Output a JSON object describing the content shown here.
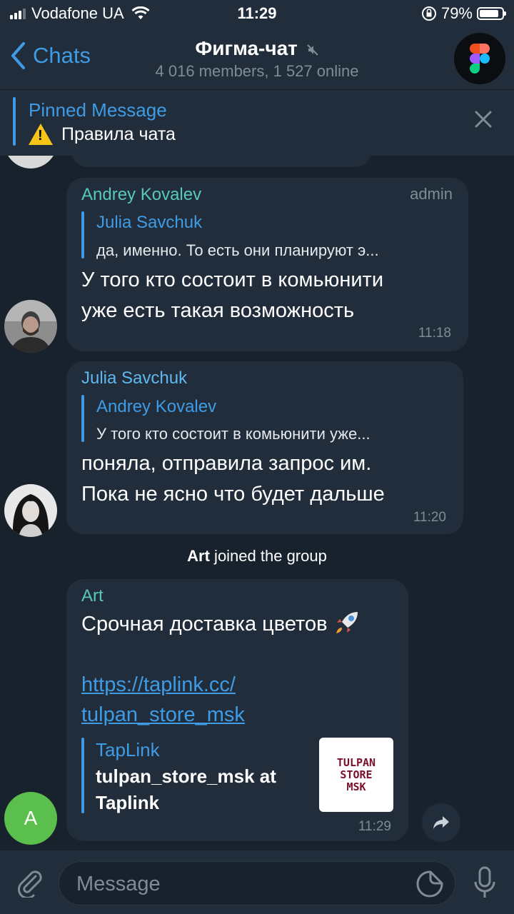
{
  "status": {
    "carrier": "Vodafone UA",
    "time": "11:29",
    "battery": "79%"
  },
  "nav": {
    "back_label": "Chats",
    "title": "Фигма-чат",
    "subtitle": "4 016 members, 1 527 online"
  },
  "pinned": {
    "title": "Pinned Message",
    "text": "Правила чата"
  },
  "messages": [
    {
      "sender": "Andrey Kovalev",
      "role": "admin",
      "reply_name": "Julia Savchuk",
      "reply_text": "да, именно. То есть они планируют э...",
      "text_line1": "У того кто состоит в комьюнити",
      "text_line2": "уже есть такая возможность",
      "time": "11:18",
      "sender_color": "#57c9b9"
    },
    {
      "sender": "Julia Savchuk",
      "reply_name": "Andrey Kovalev",
      "reply_text": "У того кто состоит в комьюнити уже...",
      "text_line1": "поняла, отправила запрос им.",
      "text_line2": "Пока не ясно что будет дальше",
      "time": "11:20",
      "sender_color": "#5fb8ef"
    },
    {
      "sender": "Art",
      "text": "Срочная доставка цветов",
      "link_line1": "https://taplink.cc/",
      "link_line2": "tulpan_store_msk",
      "preview_site": "TapLink",
      "preview_title_line1": "tulpan_store_msk at",
      "preview_title_line2": "Taplink",
      "thumb_lines": [
        "TULPAN",
        "STORE",
        "MSK"
      ],
      "time": "11:29",
      "avatar_letter": "A",
      "sender_color": "#57c9b9"
    }
  ],
  "service": {
    "name": "Art",
    "text": " joined the group"
  },
  "input": {
    "placeholder": "Message"
  },
  "colors": {
    "accent": "#3e9ce6",
    "bubble": "#212d3b",
    "background": "#18222d",
    "avatar_green": "#5bbf4d"
  }
}
